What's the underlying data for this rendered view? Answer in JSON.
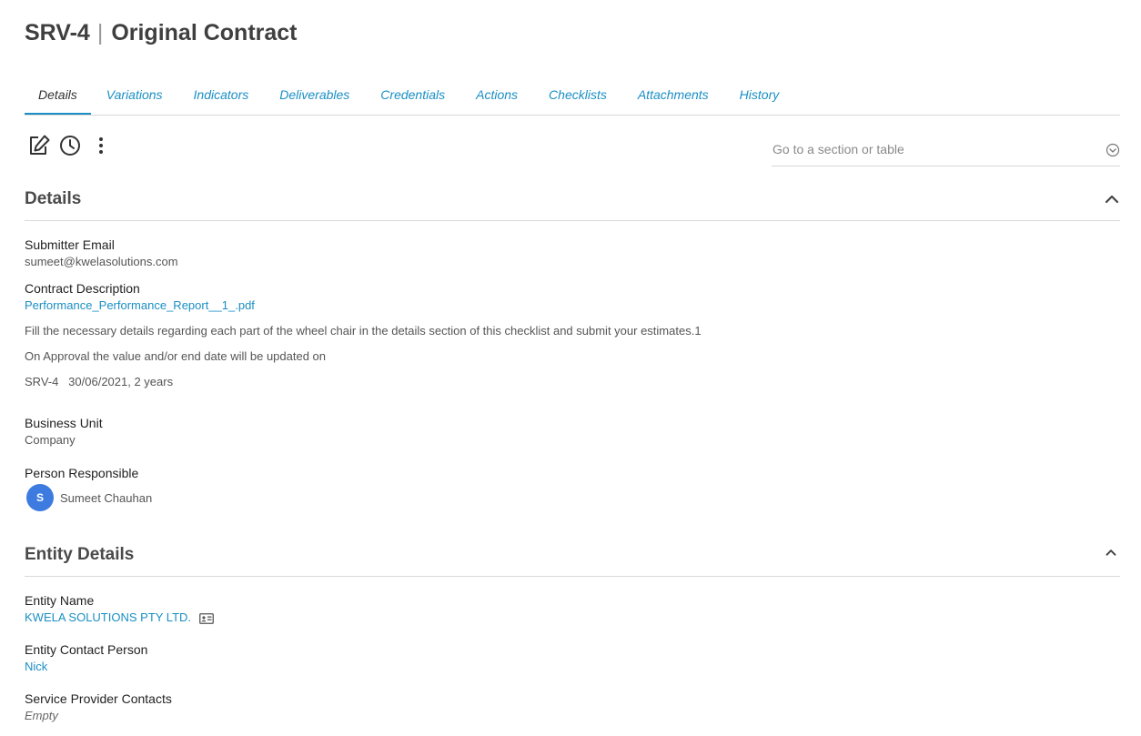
{
  "header": {
    "code": "SRV-4",
    "separator": "|",
    "title": "Original Contract"
  },
  "tabs": [
    {
      "label": "Details",
      "active": true
    },
    {
      "label": "Variations"
    },
    {
      "label": "Indicators"
    },
    {
      "label": "Deliverables"
    },
    {
      "label": "Credentials"
    },
    {
      "label": "Actions"
    },
    {
      "label": "Checklists"
    },
    {
      "label": "Attachments"
    },
    {
      "label": "History"
    }
  ],
  "toolbar": {
    "icons": [
      "edit-icon",
      "history-clock-icon",
      "more-vertical-icon"
    ],
    "goto_placeholder": "Go to a section or table"
  },
  "details_section": {
    "title": "Details",
    "submitter_email_label": "Submitter Email",
    "submitter_email": "sumeet@kwelasolutions.com",
    "contract_description_label": "Contract Description",
    "contract_attachment": "Performance_Performance_Report__1_.pdf",
    "description_line1": "Fill the necessary details regarding each part of the wheel chair in the details section of this checklist and submit your estimates.1",
    "description_line2": "On Approval the value and/or end date will be updated on",
    "description_line3": "SRV-4   30/06/2021, 2 years",
    "business_unit_label": "Business Unit",
    "business_unit": "Company",
    "person_responsible_label": "Person Responsible",
    "person_initial": "S",
    "person_name": "Sumeet Chauhan"
  },
  "entity_section": {
    "title": "Entity Details",
    "entity_name_label": "Entity Name",
    "entity_name": "KWELA SOLUTIONS PTY LTD.",
    "entity_contact_label": "Entity Contact Person",
    "entity_contact": "Nick",
    "service_provider_label": "Service Provider Contacts",
    "service_provider": "Empty"
  },
  "colors": {
    "accent": "#1a8fc4",
    "avatar": "#3d7be0"
  }
}
